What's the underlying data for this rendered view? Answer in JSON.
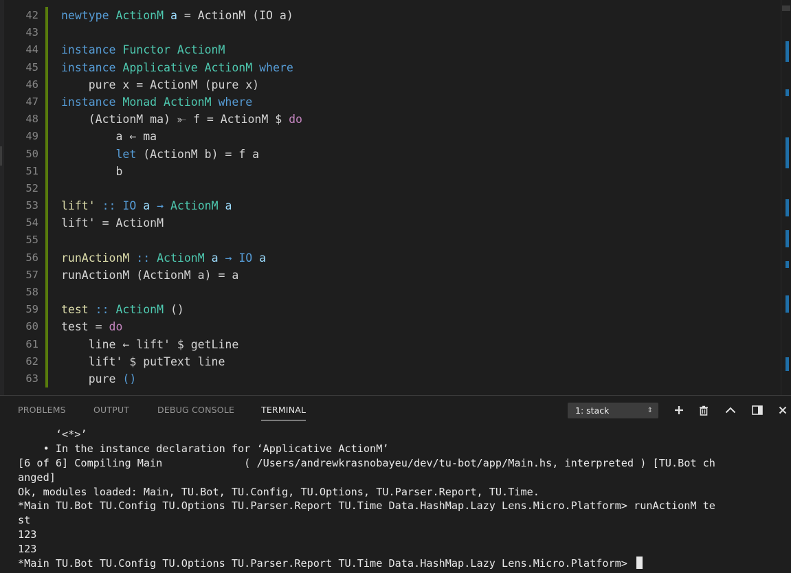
{
  "editor": {
    "lines": [
      {
        "n": "42",
        "bar": true,
        "tokens": [
          [
            "kw",
            "newtype "
          ],
          [
            "ty",
            "ActionM "
          ],
          [
            "var",
            "a"
          ],
          [
            "op",
            " = ActionM (IO a)"
          ]
        ]
      },
      {
        "n": "43",
        "bar": true,
        "tokens": []
      },
      {
        "n": "44",
        "bar": true,
        "tokens": [
          [
            "kw",
            "instance "
          ],
          [
            "ty",
            "Functor "
          ],
          [
            "ty",
            "ActionM"
          ]
        ]
      },
      {
        "n": "45",
        "bar": true,
        "tokens": [
          [
            "kw",
            "instance "
          ],
          [
            "ty",
            "Applicative "
          ],
          [
            "ty",
            "ActionM "
          ],
          [
            "kw",
            "where"
          ]
        ]
      },
      {
        "n": "46",
        "bar": true,
        "tokens": [
          [
            "op",
            "    pure x = ActionM (pure x)"
          ]
        ]
      },
      {
        "n": "47",
        "bar": true,
        "tokens": [
          [
            "kw",
            "instance "
          ],
          [
            "ty",
            "Monad "
          ],
          [
            "ty",
            "ActionM "
          ],
          [
            "kw",
            "where"
          ]
        ]
      },
      {
        "n": "48",
        "bar": true,
        "tokens": [
          [
            "op",
            "    (ActionM ma) ⤜ f = ActionM $ "
          ],
          [
            "pk",
            "do"
          ]
        ]
      },
      {
        "n": "49",
        "bar": true,
        "tokens": [
          [
            "op",
            "        a ← ma"
          ]
        ]
      },
      {
        "n": "50",
        "bar": true,
        "tokens": [
          [
            "op",
            "        "
          ],
          [
            "kw",
            "let"
          ],
          [
            "op",
            " (ActionM b) = f a"
          ]
        ]
      },
      {
        "n": "51",
        "bar": true,
        "tokens": [
          [
            "op",
            "        b"
          ]
        ]
      },
      {
        "n": "52",
        "bar": true,
        "tokens": []
      },
      {
        "n": "53",
        "bar": true,
        "tokens": [
          [
            "fn",
            "lift' "
          ],
          [
            "kw",
            ":: "
          ],
          [
            "tyb",
            "IO "
          ],
          [
            "var",
            "a "
          ],
          [
            "kw",
            "→ "
          ],
          [
            "ty",
            "ActionM "
          ],
          [
            "var",
            "a"
          ]
        ]
      },
      {
        "n": "54",
        "bar": true,
        "tokens": [
          [
            "op",
            "lift' = ActionM"
          ]
        ]
      },
      {
        "n": "55",
        "bar": true,
        "tokens": []
      },
      {
        "n": "56",
        "bar": true,
        "tokens": [
          [
            "fn",
            "runActionM "
          ],
          [
            "kw",
            ":: "
          ],
          [
            "ty",
            "ActionM "
          ],
          [
            "var",
            "a "
          ],
          [
            "kw",
            "→ "
          ],
          [
            "tyb",
            "IO "
          ],
          [
            "var",
            "a"
          ]
        ]
      },
      {
        "n": "57",
        "bar": true,
        "tokens": [
          [
            "op",
            "runActionM (ActionM a) = a"
          ]
        ]
      },
      {
        "n": "58",
        "bar": true,
        "tokens": []
      },
      {
        "n": "59",
        "bar": true,
        "tokens": [
          [
            "fn",
            "test "
          ],
          [
            "kw",
            ":: "
          ],
          [
            "ty",
            "ActionM "
          ],
          [
            "op",
            "()"
          ]
        ]
      },
      {
        "n": "60",
        "bar": true,
        "tokens": [
          [
            "op",
            "test = "
          ],
          [
            "pk",
            "do"
          ]
        ]
      },
      {
        "n": "61",
        "bar": true,
        "tokens": [
          [
            "op",
            "    line ← lift' $ getLine"
          ]
        ]
      },
      {
        "n": "62",
        "bar": true,
        "tokens": [
          [
            "op",
            "    lift' $ putText line"
          ]
        ]
      },
      {
        "n": "63",
        "bar": true,
        "tokens": [
          [
            "op",
            "    pure "
          ],
          [
            "kw",
            "()"
          ]
        ]
      }
    ]
  },
  "panel": {
    "tabs": [
      "PROBLEMS",
      "OUTPUT",
      "DEBUG CONSOLE",
      "TERMINAL"
    ],
    "active_tab": "TERMINAL",
    "terminal_select": "1: stack",
    "icons": [
      "plus-icon",
      "trash-icon",
      "chevron-up-icon",
      "split-panel-icon",
      "close-icon"
    ]
  },
  "terminal": {
    "lines": [
      "      ‘<*>’",
      "    • In the instance declaration for ‘Applicative ActionM’",
      "[6 of 6] Compiling Main             ( /Users/andrewkrasnobayeu/dev/tu-bot/app/Main.hs, interpreted ) [TU.Bot ch",
      "anged]",
      "Ok, modules loaded: Main, TU.Bot, TU.Config, TU.Options, TU.Parser.Report, TU.Time.",
      "*Main TU.Bot TU.Config TU.Options TU.Parser.Report TU.Time Data.HashMap.Lazy Lens.Micro.Platform> runActionM te",
      "st",
      "123",
      "123",
      "*Main TU.Bot TU.Config TU.Options TU.Parser.Report TU.Time Data.HashMap.Lazy Lens.Micro.Platform> "
    ]
  },
  "colors": {
    "keyword": "#569cd6",
    "type": "#4ec9b0",
    "function": "#dcdcaa",
    "do_keyword": "#c586c0",
    "git_bar": "#587c0c",
    "background": "#1e1e1e"
  }
}
